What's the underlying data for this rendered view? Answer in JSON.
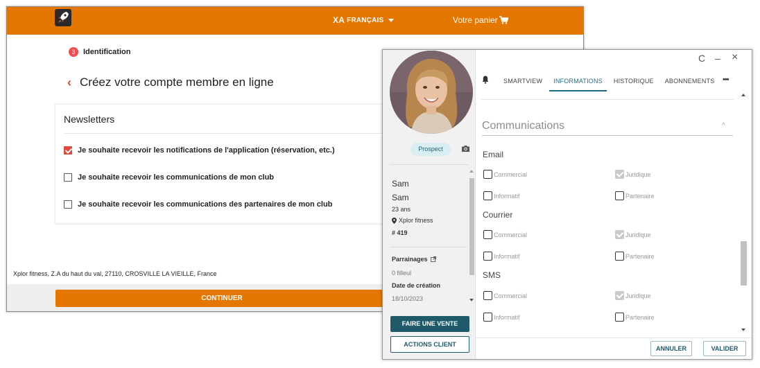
{
  "back_window": {
    "language": {
      "glyph": "XA",
      "label": "FRANÇAIS"
    },
    "cart_label": "Votre panier",
    "step": {
      "number": "3",
      "label": "Identification"
    },
    "page_title": "Créez votre compte membre en ligne",
    "newsletters": {
      "heading": "Newsletters",
      "options": [
        {
          "label": "Je souhaite recevoir les notifications de l'application (réservation, etc.)",
          "checked": true
        },
        {
          "label": "Je souhaite recevoir les communications de mon club",
          "checked": false
        },
        {
          "label": "Je souhaite recevoir les communications des partenaires de mon club",
          "checked": false
        }
      ]
    },
    "address": "Xplor fitness, Z.A du haut du val, 27110, CROSVILLE LA VIEILLE, France",
    "continue_label": "CONTINUER",
    "accent_color": "#e57700"
  },
  "front_window": {
    "window_controls": {
      "refresh": "C",
      "minimize": "–",
      "close": "×"
    },
    "status_badge": "Prospect",
    "member": {
      "first_name": "Sam",
      "last_name": "Sam",
      "age": "23 ans",
      "club": "Xplor fitness",
      "member_number": "# 419",
      "sponsorships_label": "Parrainages",
      "sponsorships_value": "0 filleul",
      "creation_label": "Date de création",
      "creation_date": "18/10/2023"
    },
    "buttons": {
      "sale": "FAIRE UNE VENTE",
      "actions": "ACTIONS CLIENT",
      "cancel": "ANNULER",
      "validate": "VALIDER"
    },
    "tabs": [
      {
        "label": "SMARTVIEW",
        "active": false
      },
      {
        "label": "INFORMATIONS",
        "active": true
      },
      {
        "label": "HISTORIQUE",
        "active": false
      },
      {
        "label": "ABONNEMENTS",
        "active": false
      }
    ],
    "more_label": "•••",
    "section_title": "Communications",
    "groups": [
      {
        "name": "Email",
        "options": [
          {
            "label": "Commercial",
            "checked": false
          },
          {
            "label": "Juridique",
            "checked": true
          },
          {
            "label": "Informatif",
            "checked": false
          },
          {
            "label": "Partenaire",
            "checked": false
          }
        ]
      },
      {
        "name": "Courrier",
        "options": [
          {
            "label": "Commercial",
            "checked": false
          },
          {
            "label": "Juridique",
            "checked": true
          },
          {
            "label": "Informatif",
            "checked": false
          },
          {
            "label": "Partenaire",
            "checked": false
          }
        ]
      },
      {
        "name": "SMS",
        "options": [
          {
            "label": "Commercial",
            "checked": false
          },
          {
            "label": "Juridique",
            "checked": true
          },
          {
            "label": "Informatif",
            "checked": false
          },
          {
            "label": "Partenaire",
            "checked": false
          }
        ]
      }
    ],
    "primary_color": "#1f5a6a"
  }
}
